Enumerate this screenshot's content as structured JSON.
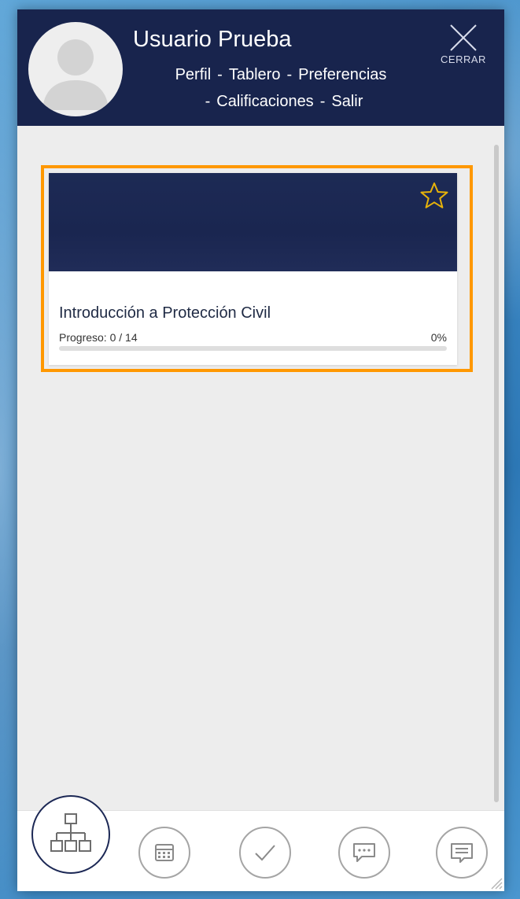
{
  "header": {
    "user_name": "Usuario Prueba",
    "nav": {
      "perfil": "Perfil",
      "tablero": "Tablero",
      "preferencias": "Preferencias",
      "calificaciones": "Calificaciones",
      "salir": "Salir",
      "separator": "-"
    },
    "close_label": "CERRAR"
  },
  "course_card": {
    "title": "Introducción a Protección Civil",
    "progress_label": "Progreso: 0 / 14",
    "progress_percent_text": "0%",
    "progress_fraction": 0,
    "favorite_icon": "star-outline-icon"
  },
  "bottom_nav": {
    "items": [
      "sitemap-icon",
      "calendar-icon",
      "check-icon",
      "chat-bubble-icon",
      "message-icon"
    ]
  },
  "colors": {
    "header_bg": "#18244d",
    "highlight_border": "#ff9800",
    "star": "#e7b30a",
    "panel_bg": "#ededed"
  }
}
